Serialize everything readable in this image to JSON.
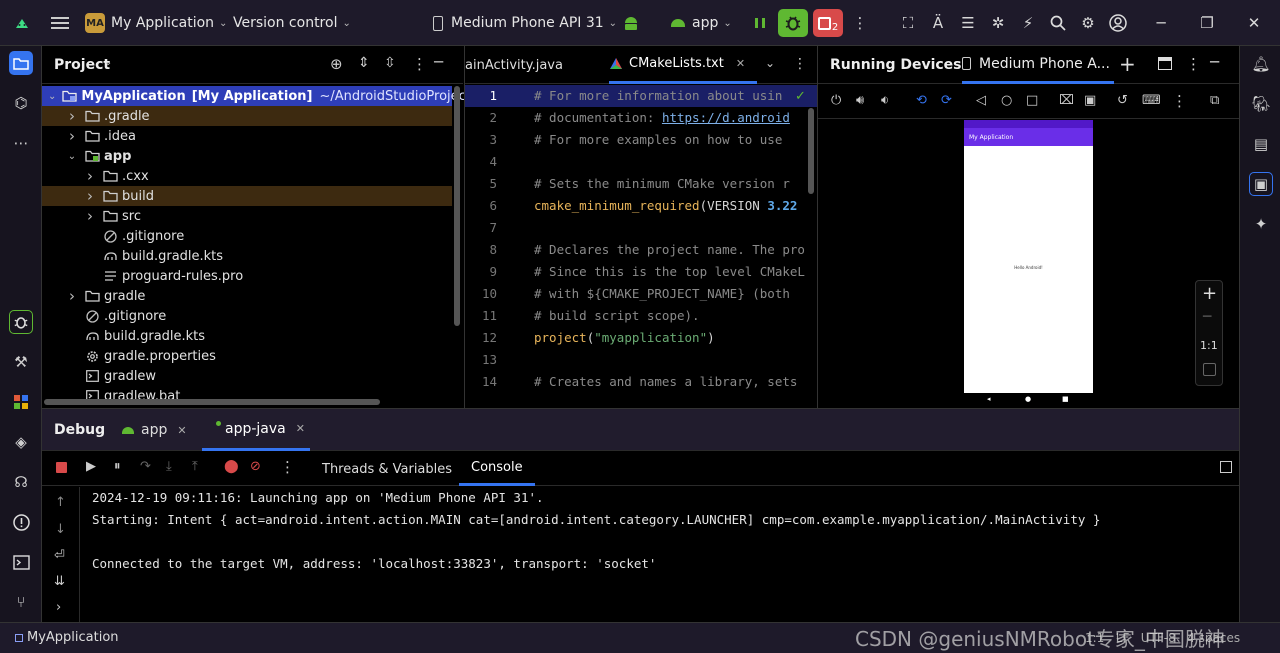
{
  "titlebar": {
    "project_badge": "MA",
    "project_name": "My Application",
    "vcs": "Version control",
    "device": "Medium Phone API 31",
    "run_config": "app",
    "badge_count": "2"
  },
  "project_panel": {
    "title": "Project",
    "tree": [
      {
        "name": "MyApplication",
        "extra": "[My Application]",
        "path": "~/AndroidStudioProjects/M",
        "depth": 0,
        "chevron": "open",
        "icon": "module",
        "selected": true
      },
      {
        "name": ".gradle",
        "depth": 1,
        "chevron": "closed",
        "icon": "folder",
        "highlight": true
      },
      {
        "name": ".idea",
        "depth": 1,
        "chevron": "closed",
        "icon": "folder"
      },
      {
        "name": "app",
        "depth": 1,
        "chevron": "open",
        "icon": "module-folder",
        "bold": true
      },
      {
        "name": ".cxx",
        "depth": 2,
        "chevron": "closed",
        "icon": "folder"
      },
      {
        "name": "build",
        "depth": 2,
        "chevron": "closed",
        "icon": "folder",
        "highlight": true
      },
      {
        "name": "src",
        "depth": 2,
        "chevron": "closed",
        "icon": "folder"
      },
      {
        "name": ".gitignore",
        "depth": 2,
        "icon": "ignore"
      },
      {
        "name": "build.gradle.kts",
        "depth": 2,
        "icon": "gradle"
      },
      {
        "name": "proguard-rules.pro",
        "depth": 2,
        "icon": "text"
      },
      {
        "name": "gradle",
        "depth": 1,
        "chevron": "closed",
        "icon": "folder"
      },
      {
        "name": ".gitignore",
        "depth": 1,
        "icon": "ignore"
      },
      {
        "name": "build.gradle.kts",
        "depth": 1,
        "icon": "gradle"
      },
      {
        "name": "gradle.properties",
        "depth": 1,
        "icon": "gear"
      },
      {
        "name": "gradlew",
        "depth": 1,
        "icon": "terminal"
      },
      {
        "name": "gradlew.bat",
        "depth": 1,
        "icon": "terminal"
      }
    ]
  },
  "editor": {
    "tabs": [
      {
        "label": "ainActivity.java"
      },
      {
        "label": "CMakeLists.txt",
        "active": true
      }
    ],
    "lines": [
      {
        "n": "1",
        "segments": [
          {
            "t": "# For more information about usin",
            "c": "comment"
          }
        ]
      },
      {
        "n": "2",
        "segments": [
          {
            "t": "# documentation: ",
            "c": "comment"
          },
          {
            "t": "https://d.android",
            "c": "link"
          }
        ]
      },
      {
        "n": "3",
        "segments": [
          {
            "t": "# For more examples on how to use ",
            "c": "comment"
          }
        ]
      },
      {
        "n": "4",
        "segments": []
      },
      {
        "n": "5",
        "segments": [
          {
            "t": "# Sets the minimum CMake version r",
            "c": "comment"
          }
        ]
      },
      {
        "n": "6",
        "segments": [
          {
            "t": "cmake_minimum_required",
            "c": "func"
          },
          {
            "t": "(VERSION ",
            "c": "plain"
          },
          {
            "t": "3.22",
            "c": "num"
          }
        ]
      },
      {
        "n": "7",
        "segments": []
      },
      {
        "n": "8",
        "segments": [
          {
            "t": "# Declares the project name. The pro",
            "c": "comment"
          }
        ]
      },
      {
        "n": "9",
        "segments": [
          {
            "t": "# Since this is the top level CMakeL",
            "c": "comment"
          }
        ]
      },
      {
        "n": "10",
        "segments": [
          {
            "t": "# with ${CMAKE_PROJECT_NAME} (both ",
            "c": "comment"
          }
        ]
      },
      {
        "n": "11",
        "segments": [
          {
            "t": "# build script scope).",
            "c": "comment"
          }
        ]
      },
      {
        "n": "12",
        "segments": [
          {
            "t": "project",
            "c": "func"
          },
          {
            "t": "(",
            "c": "plain"
          },
          {
            "t": "\"myapplication\"",
            "c": "str"
          },
          {
            "t": ")",
            "c": "plain"
          }
        ]
      },
      {
        "n": "13",
        "segments": []
      },
      {
        "n": "14",
        "segments": [
          {
            "t": "# Creates and names a library, sets",
            "c": "comment"
          }
        ]
      }
    ]
  },
  "devices": {
    "title": "Running Devices",
    "tab": "Medium Phone A...",
    "phone_app_title": "My Application",
    "phone_content": "Hello Android!",
    "zoom_label": "1:1"
  },
  "debug": {
    "title": "Debug",
    "tabs": [
      {
        "label": "app"
      },
      {
        "label": "app-java",
        "active": true
      }
    ],
    "subtabs": [
      {
        "label": "Threads & Variables"
      },
      {
        "label": "Console",
        "active": true
      }
    ],
    "console": [
      "2024-12-19 09:11:16: Launching app on 'Medium Phone API 31'.",
      "Starting: Intent { act=android.intent.action.MAIN cat=[android.intent.category.LAUNCHER] cmp=com.example.myapplication/.MainActivity }",
      "",
      "Connected to the target VM, address: 'localhost:33823', transport: 'socket'"
    ]
  },
  "statusbar": {
    "project": "MyApplication",
    "right": "1:1   LF   UTF-8   4 spaces"
  },
  "watermark": "CSDN @geniusNMRobot专家_中国脱神",
  "colors": {
    "accent": "#3574f0",
    "selection": "#2e3eb8",
    "highlight_row": "#3d2a10",
    "debug_green": "#5fb832",
    "badge_red": "#d84a4a",
    "phone_purple": "#6a2ee8"
  }
}
